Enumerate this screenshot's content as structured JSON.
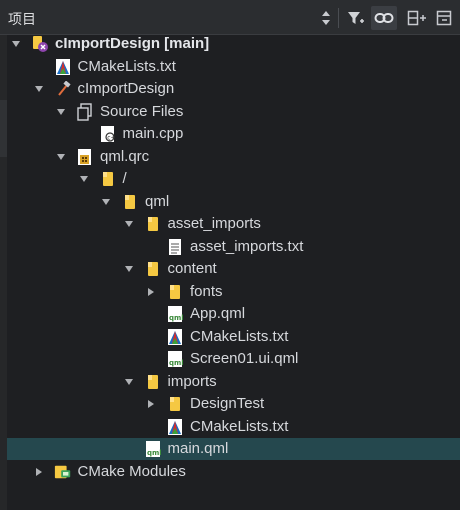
{
  "header": {
    "title": "项目"
  },
  "toolbar": {
    "buttons": [
      {
        "name": "sort-updown-icon"
      },
      {
        "name": "filter-icon"
      },
      {
        "name": "link-icon"
      },
      {
        "name": "split-icon"
      },
      {
        "name": "close-panel-icon"
      }
    ]
  },
  "tree": [
    {
      "label": "cImportDesign [main]",
      "level": 0,
      "expanded": true,
      "icon": "project-icon",
      "bold": true
    },
    {
      "label": "CMakeLists.txt",
      "level": 1,
      "icon": "cmake-file-icon"
    },
    {
      "label": "cImportDesign",
      "level": 1,
      "expanded": true,
      "icon": "hammer-icon"
    },
    {
      "label": "Source Files",
      "level": 2,
      "expanded": true,
      "icon": "source-files-icon"
    },
    {
      "label": "main.cpp",
      "level": 3,
      "icon": "cpp-file-icon"
    },
    {
      "label": "qml.qrc",
      "level": 2,
      "expanded": true,
      "icon": "qrc-file-icon"
    },
    {
      "label": "/",
      "level": 3,
      "expanded": true,
      "icon": "folder-icon"
    },
    {
      "label": "qml",
      "level": 4,
      "expanded": true,
      "icon": "folder-icon"
    },
    {
      "label": "asset_imports",
      "level": 5,
      "expanded": true,
      "icon": "folder-icon"
    },
    {
      "label": "asset_imports.txt",
      "level": 6,
      "icon": "text-file-icon"
    },
    {
      "label": "content",
      "level": 5,
      "expanded": true,
      "icon": "folder-icon"
    },
    {
      "label": "fonts",
      "level": 6,
      "expanded": false,
      "icon": "folder-icon"
    },
    {
      "label": "App.qml",
      "level": 6,
      "icon": "qml-file-icon"
    },
    {
      "label": "CMakeLists.txt",
      "level": 6,
      "icon": "cmake-file-icon"
    },
    {
      "label": "Screen01.ui.qml",
      "level": 6,
      "icon": "qml-file-icon"
    },
    {
      "label": "imports",
      "level": 5,
      "expanded": true,
      "icon": "folder-icon"
    },
    {
      "label": "DesignTest",
      "level": 6,
      "expanded": false,
      "icon": "folder-icon"
    },
    {
      "label": "CMakeLists.txt",
      "level": 6,
      "icon": "cmake-file-icon"
    },
    {
      "label": "main.qml",
      "level": 5,
      "icon": "qml-file-icon",
      "selected": true
    },
    {
      "label": "CMake Modules",
      "level": 1,
      "expanded": false,
      "icon": "cmake-modules-icon"
    }
  ],
  "colors": {
    "selection": "#25484e",
    "folder": "#f5c842",
    "background": "#1e1f22"
  }
}
